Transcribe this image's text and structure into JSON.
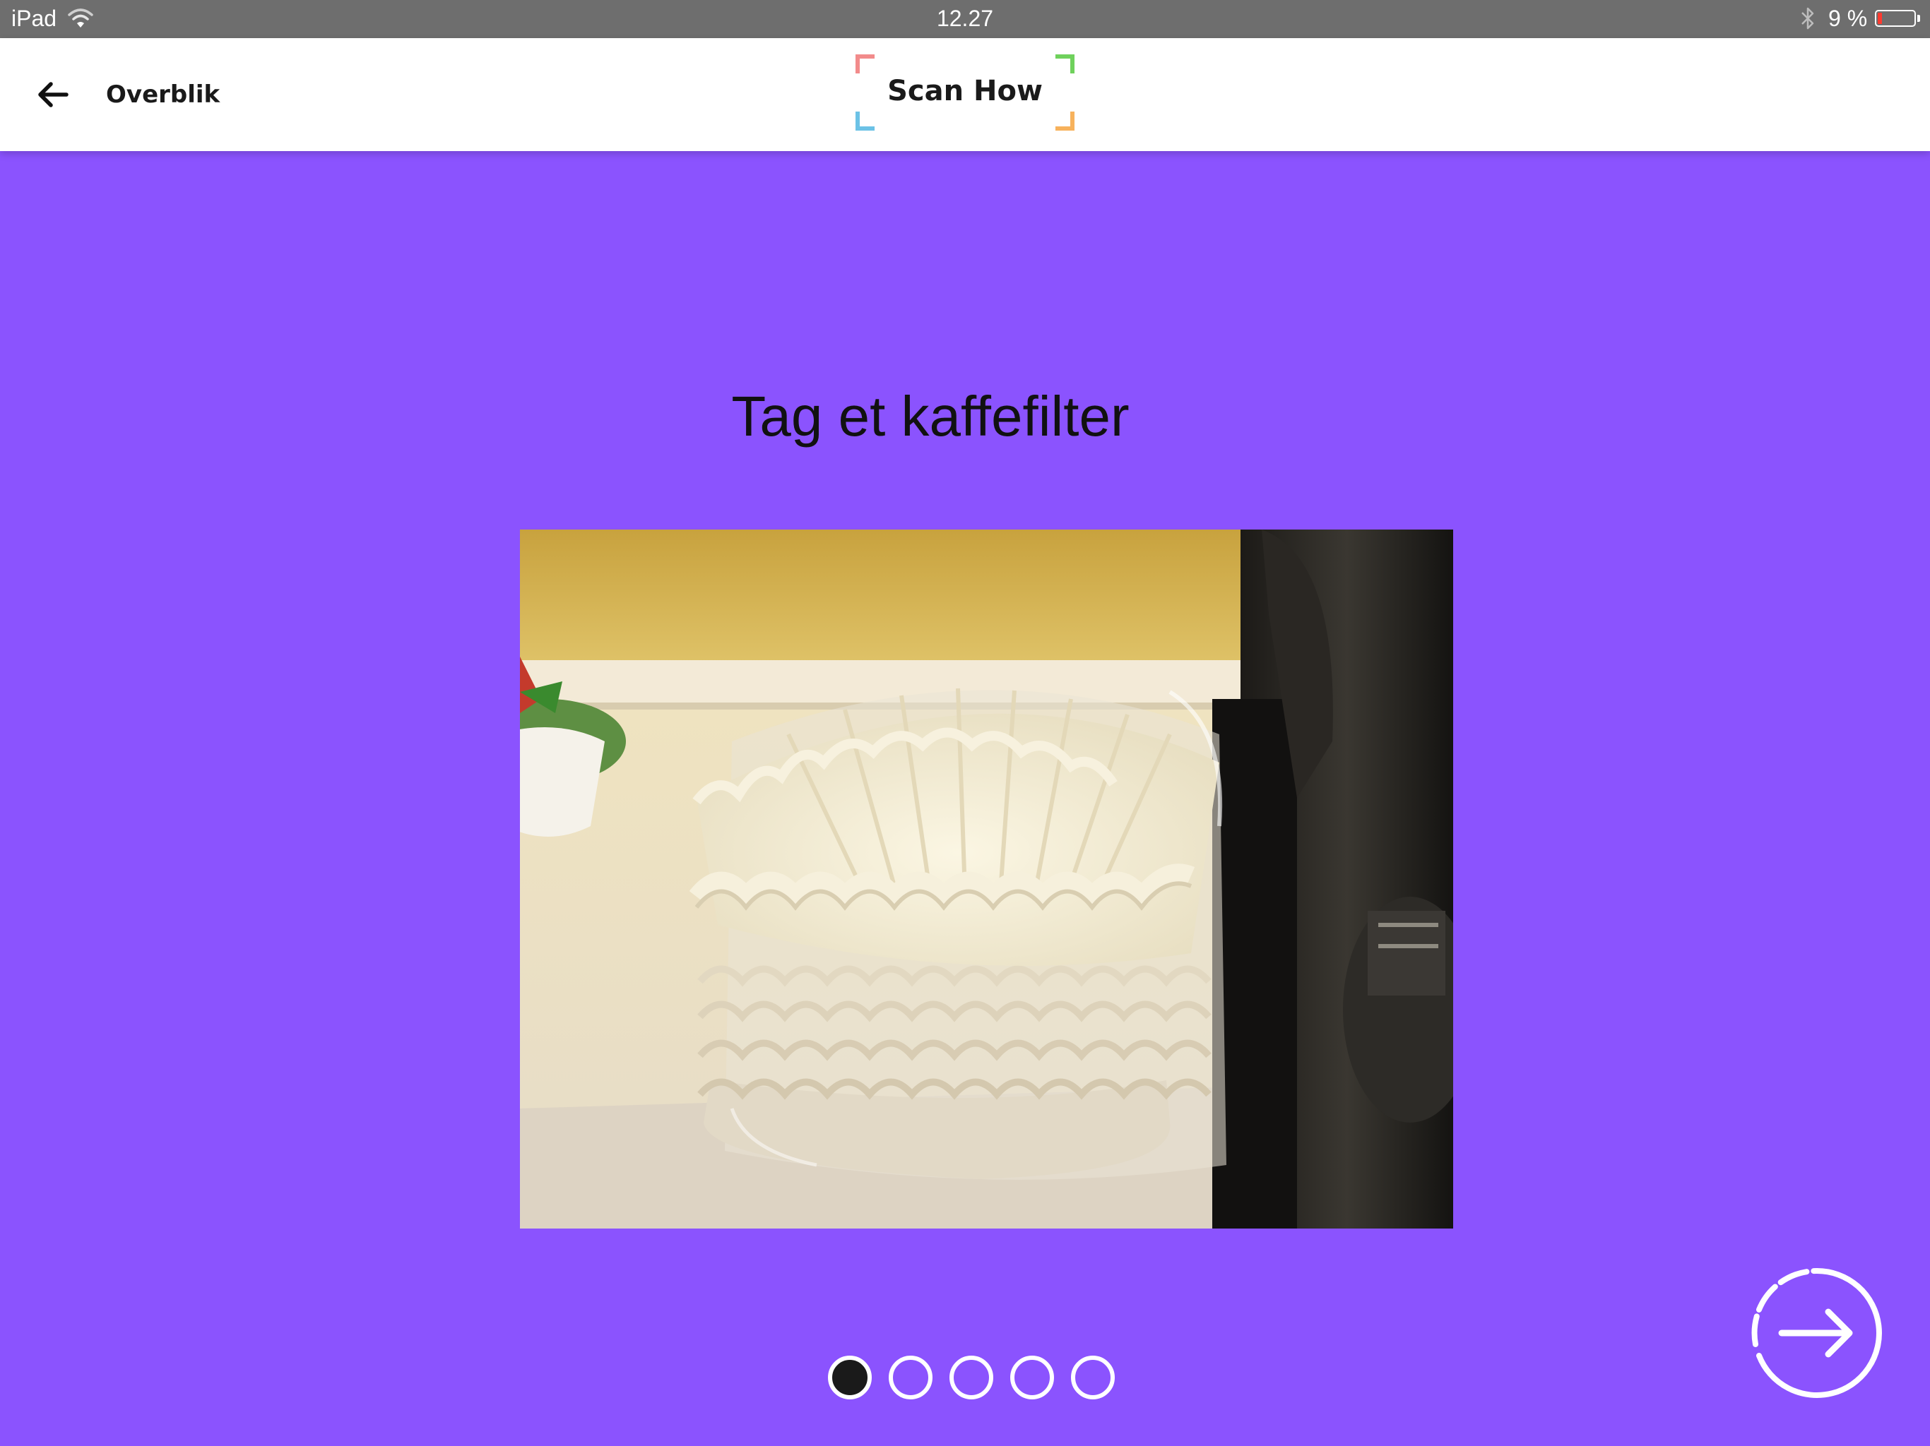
{
  "status_bar": {
    "device": "iPad",
    "time": "12.27",
    "battery": "9 %",
    "battery_level": 0.09
  },
  "header": {
    "back_label": "Overblik",
    "logo_text": "Scan How",
    "logo_colors": [
      "#f28b8b",
      "#6fd15c",
      "#6cc2e6",
      "#f7b25c"
    ]
  },
  "step": {
    "title": "Tag et kaffefilter"
  },
  "pager": {
    "count": 5,
    "active_index": 0
  },
  "theme": {
    "background": "#8b53fe",
    "header": "#ffffff",
    "status_bar": "#6e6e6e"
  },
  "icons": {
    "back": "arrow-left-icon",
    "next": "arrow-right-circle-icon",
    "wifi": "wifi-icon",
    "bluetooth": "bluetooth-icon",
    "battery": "battery-icon"
  }
}
